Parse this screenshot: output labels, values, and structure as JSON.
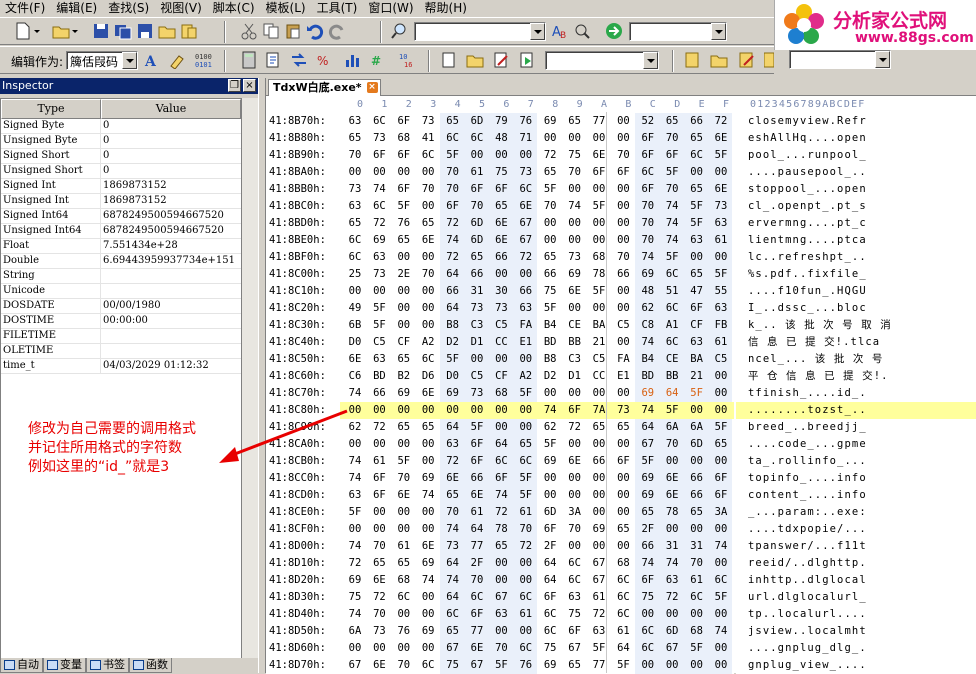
{
  "menu": [
    "文件(F)",
    "编辑(E)",
    "查找(S)",
    "视图(V)",
    "脚本(C)",
    "模板(L)",
    "工具(T)",
    "窗口(W)",
    "帮助(H)"
  ],
  "logo": {
    "title": "分析家公式网",
    "url": "www.88gs.com"
  },
  "toolbar": {
    "edit_as_label": "编辑作为:",
    "edit_as_value": "簰佸叚码"
  },
  "inspector": {
    "title": "Inspector",
    "col_type": "Type",
    "col_value": "Value",
    "rows": [
      {
        "k": "Signed Byte",
        "v": "0"
      },
      {
        "k": "Unsigned Byte",
        "v": "0"
      },
      {
        "k": "Signed Short",
        "v": "0"
      },
      {
        "k": "Unsigned Short",
        "v": "0"
      },
      {
        "k": "Signed Int",
        "v": "1869873152"
      },
      {
        "k": "Unsigned Int",
        "v": "1869873152"
      },
      {
        "k": "Signed Int64",
        "v": "6878249500594667520"
      },
      {
        "k": "Unsigned Int64",
        "v": "6878249500594667520"
      },
      {
        "k": "Float",
        "v": "7.551434e+28"
      },
      {
        "k": "Double",
        "v": "6.69443959937734e+151"
      },
      {
        "k": "String",
        "v": ""
      },
      {
        "k": "Unicode",
        "v": ""
      },
      {
        "k": "DOSDATE",
        "v": "00/00/1980"
      },
      {
        "k": "DOSTIME",
        "v": "00:00:00"
      },
      {
        "k": "FILETIME",
        "v": ""
      },
      {
        "k": "OLETIME",
        "v": ""
      },
      {
        "k": "time_t",
        "v": "04/03/2029 01:12:32"
      }
    ],
    "tabs": [
      "自动",
      "变量",
      "书签",
      "函数"
    ]
  },
  "editor": {
    "file_tab": "TdxW白底.exe*",
    "col_header_hex": [
      "0",
      "1",
      "2",
      "3",
      "4",
      "5",
      "6",
      "7",
      "8",
      "9",
      "A",
      "B",
      "C",
      "D",
      "E",
      "F"
    ],
    "col_header_ascii": "0123456789ABCDEF",
    "rows": [
      {
        "a": "41:8B70h:",
        "h": "63 6C 6F 73 65 6D 79 76 69 65 77 00 52 65 66 72",
        "t": "closemyview.Refr"
      },
      {
        "a": "41:8B80h:",
        "h": "65 73 68 41 6C 6C 48 71 00 00 00 00 6F 70 65 6E",
        "t": "eshAllHq....open"
      },
      {
        "a": "41:8B90h:",
        "h": "70 6F 6F 6C 5F 00 00 00 72 75 6E 70 6F 6F 6C 5F",
        "t": "pool_...runpool_"
      },
      {
        "a": "41:8BA0h:",
        "h": "00 00 00 00 70 61 75 73 65 70 6F 6F 6C 5F 00 00",
        "t": "....pausepool_.."
      },
      {
        "a": "41:8BB0h:",
        "h": "73 74 6F 70 70 6F 6F 6C 5F 00 00 00 6F 70 65 6E",
        "t": "stoppool_...open"
      },
      {
        "a": "41:8BC0h:",
        "h": "63 6C 5F 00 6F 70 65 6E 70 74 5F 00 70 74 5F 73",
        "t": "cl_.openpt_.pt_s"
      },
      {
        "a": "41:8BD0h:",
        "h": "65 72 76 65 72 6D 6E 67 00 00 00 00 70 74 5F 63",
        "t": "ervermng....pt_c"
      },
      {
        "a": "41:8BE0h:",
        "h": "6C 69 65 6E 74 6D 6E 67 00 00 00 00 70 74 63 61",
        "t": "lientmng....ptca"
      },
      {
        "a": "41:8BF0h:",
        "h": "6C 63 00 00 72 65 66 72 65 73 68 70 74 5F 00 00",
        "t": "lc..refreshpt_.."
      },
      {
        "a": "41:8C00h:",
        "h": "25 73 2E 70 64 66 00 00 66 69 78 66 69 6C 65 5F",
        "t": "%s.pdf..fixfile_"
      },
      {
        "a": "41:8C10h:",
        "h": "00 00 00 00 66 31 30 66 75 6E 5F 00 48 51 47 55",
        "t": "....f10fun_.HQGU"
      },
      {
        "a": "41:8C20h:",
        "h": "49 5F 00 00 64 73 73 63 5F 00 00 00 62 6C 6F 63",
        "t": "I_..dssc_...bloc"
      },
      {
        "a": "41:8C30h:",
        "h": "6B 5F 00 00 B8 C3 C5 FA B4 CE BA C5 C8 A1 CF FB",
        "t": "k_.. 该 批 次 号 取 消"
      },
      {
        "a": "41:8C40h:",
        "h": "D0 C5 CF A2 D2 D1 CC E1 BD BB 21 00 74 6C 63 61",
        "t": "信 息 已 提 交!.tlca"
      },
      {
        "a": "41:8C50h:",
        "h": "6E 63 65 6C 5F 00 00 00 B8 C3 C5 FA B4 CE BA C5",
        "t": "ncel_... 该 批 次 号"
      },
      {
        "a": "41:8C60h:",
        "h": "C6 BD B2 D6 D0 C5 CF A2 D2 D1 CC E1 BD BB 21 00",
        "t": "平 仓 信 息 已 提 交!."
      },
      {
        "a": "41:8C70h:",
        "h": "74 66 69 6E 69 73 68 5F 00 00 00 00 69 64 5F 00",
        "t": "tfinish_....id_."
      },
      {
        "a": "41:8C80h:",
        "h": "00 00 00 00 00 00 00 00 74 6F 7A 73 74 5F 00 00",
        "t": "........tozst_.."
      },
      {
        "a": "41:8C90h:",
        "h": "62 72 65 65 64 5F 00 00 62 72 65 65 64 6A 6A 5F",
        "t": "breed_..breedjj_"
      },
      {
        "a": "41:8CA0h:",
        "h": "00 00 00 00 63 6F 64 65 5F 00 00 00 67 70 6D 65",
        "t": "....code_...gpme"
      },
      {
        "a": "41:8CB0h:",
        "h": "74 61 5F 00 72 6F 6C 6C 69 6E 66 6F 5F 00 00 00",
        "t": "ta_.rollinfo_..."
      },
      {
        "a": "41:8CC0h:",
        "h": "74 6F 70 69 6E 66 6F 5F 00 00 00 00 69 6E 66 6F",
        "t": "topinfo_....info"
      },
      {
        "a": "41:8CD0h:",
        "h": "63 6F 6E 74 65 6E 74 5F 00 00 00 00 69 6E 66 6F",
        "t": "content_....info"
      },
      {
        "a": "41:8CE0h:",
        "h": "5F 00 00 00 70 61 72 61 6D 3A 00 00 65 78 65 3A",
        "t": "_...param:..exe:"
      },
      {
        "a": "41:8CF0h:",
        "h": "00 00 00 00 74 64 78 70 6F 70 69 65 2F 00 00 00",
        "t": "....tdxpopie/..."
      },
      {
        "a": "41:8D00h:",
        "h": "74 70 61 6E 73 77 65 72 2F 00 00 00 66 31 31 74",
        "t": "tpanswer/...f11t"
      },
      {
        "a": "41:8D10h:",
        "h": "72 65 65 69 64 2F 00 00 64 6C 67 68 74 74 70 00",
        "t": "reeid/..dlghttp."
      },
      {
        "a": "41:8D20h:",
        "h": "69 6E 68 74 74 70 00 00 64 6C 67 6C 6F 63 61 6C",
        "t": "inhttp..dlglocal"
      },
      {
        "a": "41:8D30h:",
        "h": "75 72 6C 00 64 6C 67 6C 6F 63 61 6C 75 72 6C 5F",
        "t": "url.dlglocalurl_"
      },
      {
        "a": "41:8D40h:",
        "h": "74 70 00 00 6C 6F 63 61 6C 75 72 6C 00 00 00 00",
        "t": "tp..localurl...."
      },
      {
        "a": "41:8D50h:",
        "h": "6A 73 76 69 65 77 00 00 6C 6F 63 61 6C 6D 68 74",
        "t": "jsview..localmht"
      },
      {
        "a": "41:8D60h:",
        "h": "00 00 00 00 67 6E 70 6C 75 67 5F 64 6C 67 5F 00",
        "t": "....gnplug_dlg_."
      },
      {
        "a": "41:8D70h:",
        "h": "67 6E 70 6C 75 67 5F 76 69 65 77 5F 00 00 00 00",
        "t": "gnplug_view_...."
      }
    ]
  },
  "annotation": {
    "lines": [
      "修改为自己需要的调用格式",
      "并记住所用格式的字符数",
      "例如这里的“id_”就是3"
    ]
  }
}
